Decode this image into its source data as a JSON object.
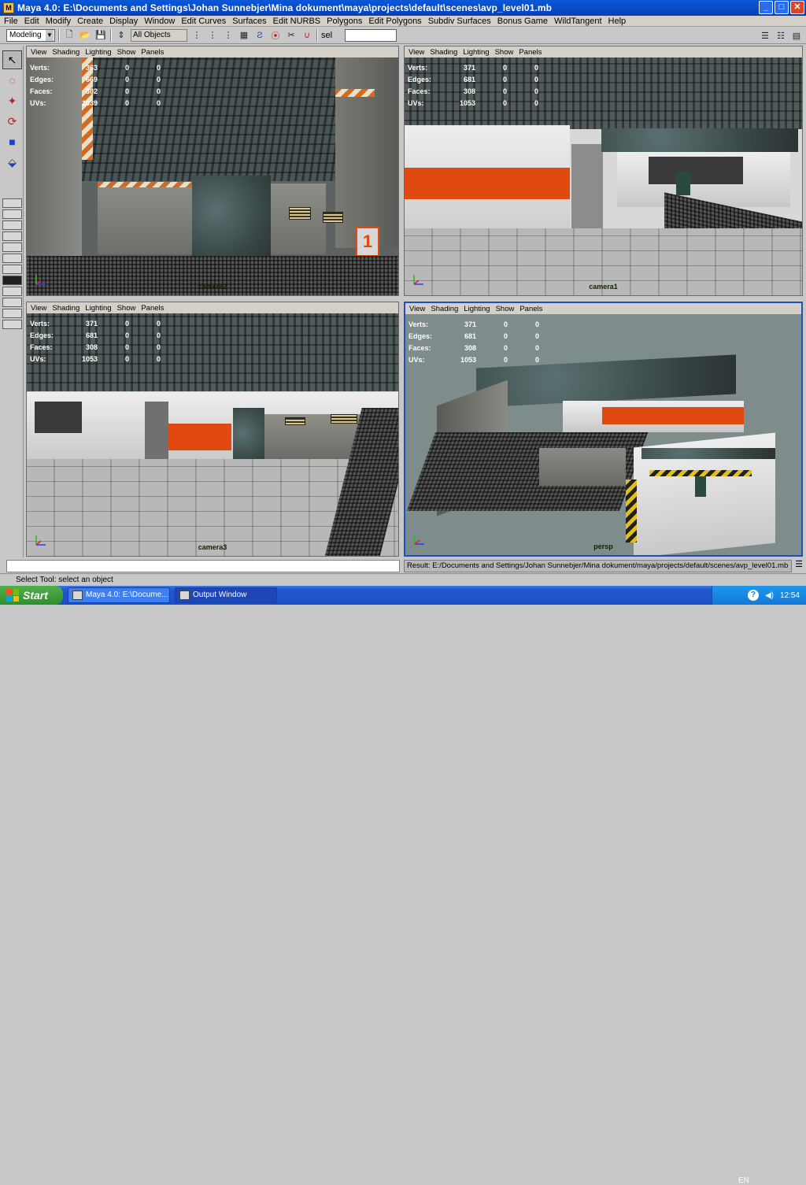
{
  "window": {
    "title": "Maya 4.0: E:\\Documents and Settings\\Johan Sunnebjer\\Mina dokument\\maya\\projects\\default\\scenes\\avp_level01.mb",
    "buttons": [
      "minimize-icon",
      "maximize-icon",
      "close-icon"
    ]
  },
  "menubar": [
    "File",
    "Edit",
    "Modify",
    "Create",
    "Display",
    "Window",
    "Edit Curves",
    "Surfaces",
    "Edit NURBS",
    "Polygons",
    "Edit Polygons",
    "Subdiv Surfaces",
    "Bonus Game",
    "WildTangent",
    "Help"
  ],
  "toolbar": {
    "mode": "Modeling",
    "object_filter": "All Objects",
    "sel_label": "sel",
    "sel_value": ""
  },
  "viewport_menu": [
    "View",
    "Shading",
    "Lighting",
    "Show",
    "Panels"
  ],
  "viewports": [
    {
      "camera": "camera2",
      "active": false,
      "stats": [
        {
          "label": "Verts:",
          "values": [
            "363",
            "0",
            "0"
          ]
        },
        {
          "label": "Edges:",
          "values": [
            "669",
            "0",
            "0"
          ]
        },
        {
          "label": "Faces:",
          "values": [
            "302",
            "0",
            "0"
          ]
        },
        {
          "label": "UVs:",
          "values": [
            "1039",
            "0",
            "0"
          ]
        }
      ]
    },
    {
      "camera": "camera1",
      "active": false,
      "stats": [
        {
          "label": "Verts:",
          "values": [
            "371",
            "0",
            "0"
          ]
        },
        {
          "label": "Edges:",
          "values": [
            "681",
            "0",
            "0"
          ]
        },
        {
          "label": "Faces:",
          "values": [
            "308",
            "0",
            "0"
          ]
        },
        {
          "label": "UVs:",
          "values": [
            "1053",
            "0",
            "0"
          ]
        }
      ]
    },
    {
      "camera": "camera3",
      "active": false,
      "stats": [
        {
          "label": "Verts:",
          "values": [
            "371",
            "0",
            "0"
          ]
        },
        {
          "label": "Edges:",
          "values": [
            "681",
            "0",
            "0"
          ]
        },
        {
          "label": "Faces:",
          "values": [
            "308",
            "0",
            "0"
          ]
        },
        {
          "label": "UVs:",
          "values": [
            "1053",
            "0",
            "0"
          ]
        }
      ]
    },
    {
      "camera": "persp",
      "active": true,
      "stats": [
        {
          "label": "Verts:",
          "values": [
            "371",
            "0",
            "0"
          ]
        },
        {
          "label": "Edges:",
          "values": [
            "681",
            "0",
            "0"
          ]
        },
        {
          "label": "Faces:",
          "values": [
            "308",
            "0",
            "0"
          ]
        },
        {
          "label": "UVs:",
          "values": [
            "1053",
            "0",
            "0"
          ]
        }
      ]
    }
  ],
  "scene_sign": "1",
  "statusbar": {
    "result": "Result: E:/Documents and Settings/Johan Sunnebjer/Mina dokument/maya/projects/default/scenes/avp_level01.mb",
    "help": "Select Tool: select an object"
  },
  "taskbar": {
    "start": "Start",
    "tasks": [
      {
        "label": "Maya 4.0: E:\\Docume...",
        "active": false
      },
      {
        "label": "Output Window",
        "active": true
      }
    ],
    "language": "EN",
    "clock": "12:54"
  },
  "colors": {
    "title_bar": "#0a58d8",
    "active_viewport_border": "#1f4fb8",
    "accent_orange": "#e04a10",
    "taskbar": "#2258d0",
    "start_green": "#3fa03a"
  }
}
